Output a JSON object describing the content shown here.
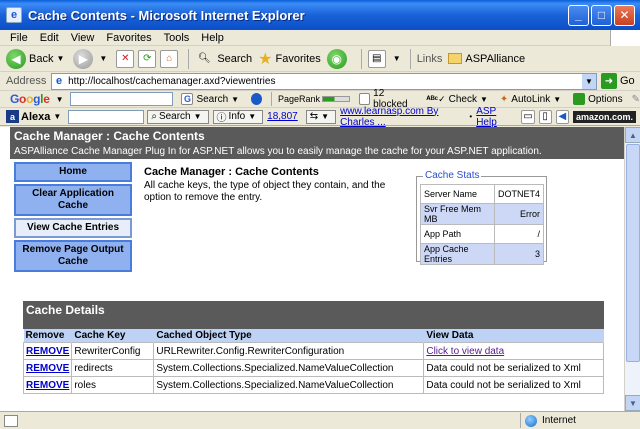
{
  "window": {
    "title": "Cache Contents - Microsoft Internet Explorer"
  },
  "menu": [
    "File",
    "Edit",
    "View",
    "Favorites",
    "Tools",
    "Help"
  ],
  "toolbar": {
    "back": "Back",
    "search": "Search",
    "favorites": "Favorites",
    "links": "Links",
    "link_item": "ASPAlliance"
  },
  "address": {
    "label": "Address",
    "url": "http://localhost/cachemanager.axd?viewentries",
    "go": "Go"
  },
  "google_bar": {
    "logo": [
      "G",
      "o",
      "o",
      "g",
      "l",
      "e"
    ],
    "search": "Search",
    "pagerank": "PageRank",
    "blocked": "12 blocked",
    "check": "Check",
    "autolink": "AutoLink",
    "options": "Options"
  },
  "alexa_bar": {
    "logo": "Alexa",
    "search": "Search",
    "info": "Info",
    "rank": "18,807",
    "link": "www.learnasp.com By Charles ...",
    "help": "ASP Help",
    "amazon": "amazon.com."
  },
  "page": {
    "header_title": "Cache Manager : Cache Contents",
    "header_desc": "ASPAlliance Cache Manager Plug In for ASP.NET allows you to easily manage the cache for your ASP.NET application.",
    "nav": [
      {
        "label": "Home",
        "active": false
      },
      {
        "label": "Clear Application Cache",
        "active": false
      },
      {
        "label": "View Cache Entries",
        "active": true
      },
      {
        "label": "Remove Page Output Cache",
        "active": false
      }
    ],
    "main_title": "Cache Manager : Cache Contents",
    "main_desc": "All cache keys, the type of object they contain, and the option to remove the entry.",
    "stats": {
      "legend": "Cache Stats",
      "rows": [
        {
          "label": "Server Name",
          "value": "DOTNET4"
        },
        {
          "label": "Svr Free Mem MB",
          "value": "Error"
        },
        {
          "label": "App Path",
          "value": "/"
        },
        {
          "label": "App Cache Entries",
          "value": "3"
        }
      ]
    },
    "details": {
      "title": "Cache Details",
      "columns": [
        "Remove",
        "Cache Key",
        "Cached Object Type",
        "View Data"
      ],
      "rows": [
        {
          "remove": "REMOVE",
          "key": "RewriterConfig",
          "type": "URLRewriter.Config.RewriterConfiguration",
          "view": "Click to view data",
          "view_link": true
        },
        {
          "remove": "REMOVE",
          "key": "redirects",
          "type": "System.Collections.Specialized.NameValueCollection",
          "view": "Data could not be serialized to Xml",
          "view_link": false
        },
        {
          "remove": "REMOVE",
          "key": "roles",
          "type": "System.Collections.Specialized.NameValueCollection",
          "view": "Data could not be serialized to Xml",
          "view_link": false
        }
      ]
    }
  },
  "status": {
    "zone": "Internet"
  }
}
